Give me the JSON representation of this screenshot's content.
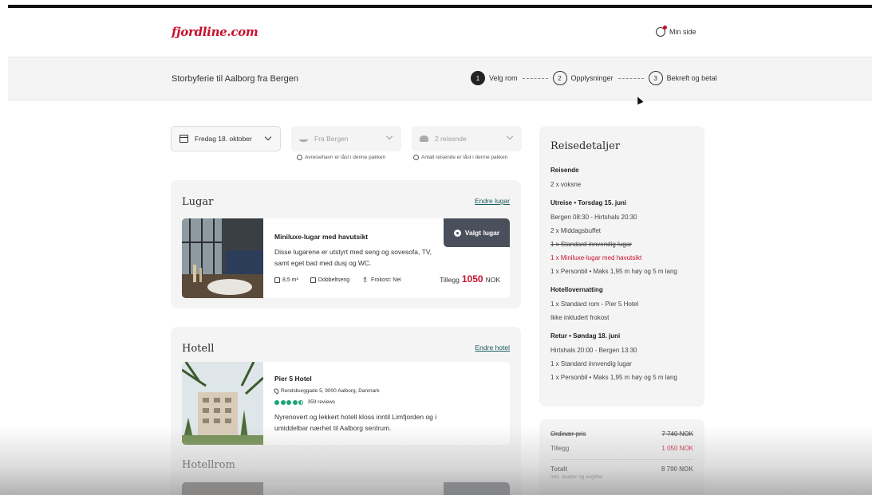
{
  "header": {
    "logo_text": "fjordline.com",
    "my_page_label": "Min side"
  },
  "subbar": {
    "trip_title": "Storbyferie til Aalborg fra Bergen",
    "steps": [
      {
        "num": "1",
        "label": "Velg rom"
      },
      {
        "num": "2",
        "label": "Opplysninger"
      },
      {
        "num": "3",
        "label": "Bekreft og betal"
      }
    ]
  },
  "filters": {
    "date": "Fredag 18. oktober",
    "departure": "Fra Bergen",
    "travelers": "2 reisende",
    "departure_note": "Avreisehavn er låst i denne pakken",
    "travelers_note": "Antall reisende er låst i denne pakken"
  },
  "cabin": {
    "title": "Lugar",
    "change_link": "Endre lugar",
    "name": "Miniluxe-lugar med havutsikt",
    "description": "Disse lugarene er utstyrt med seng og sovesofa, TV, samt eget bad med dusj og WC.",
    "specs": [
      "8,5 m²",
      "Dobbeltseng",
      "Frokost: Nei"
    ],
    "price_label": "Tillegg",
    "price_amount": "1050",
    "price_currency": "NOK",
    "selected_label": "Valgt lugar"
  },
  "hotel": {
    "title": "Hotell",
    "change_link": "Endre hotel",
    "name": "Pier 5 Hotel",
    "address": "Rendsburggade 5, 9000 Aalborg, Danmark",
    "rating": 4.5,
    "reviews": "359 reviews",
    "description": "Nyrenovert og lekkert hotell kloss inntil Limfjorden og i umiddelbar nærhet til Aalborg sentrum."
  },
  "hotel_room": {
    "title": "Hotellrom"
  },
  "details": {
    "title": "Reisedetaljer",
    "travelers_title": "Reisende",
    "travelers": "2 x voksne",
    "outbound_title": "Utreise • Torsdag 15. juni",
    "outbound_lines": [
      "Bergen 08:30 - Hirtshals 20:30",
      "2 x Middagsbuffet"
    ],
    "outbound_old_cabin": "1 x Standard innvendig lugar",
    "outbound_new_cabin": "1 x Miniluxe-lugar med havutsikt",
    "outbound_car": "1 x Personbil • Maks 1,95 m høy og 5 m lang",
    "hotel_title": "Hotellovernatting",
    "hotel_lines": [
      "1 x Standard rom - Pier 5 Hotel",
      "Ikke inkludert frokost"
    ],
    "return_title": "Retur • Søndag 18. juni",
    "return_lines": [
      "Hirtshals 20:00 - Bergen 13:30",
      "1 x Standard innvendig lugar",
      "1 x Personbil • Maks 1,95 m høy og 5 m lang"
    ]
  },
  "pricing": {
    "ordinary_label": "Ordinær pris",
    "ordinary_value": "7 740 NOK",
    "extra_label": "Tillegg",
    "extra_value": "1 050 NOK",
    "total_label": "Totalt",
    "total_value": "8 790 NOK",
    "note": "Inkl. skatter og avgifter"
  },
  "colors": {
    "brand": "#c8102e",
    "button": "#4a4f5c",
    "link": "#1a5a5a",
    "rating": "#1ea47a"
  }
}
